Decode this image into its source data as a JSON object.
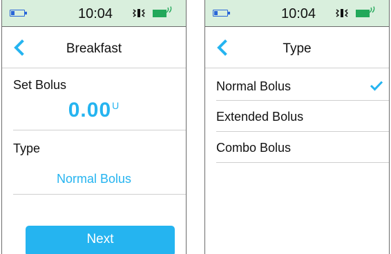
{
  "status": {
    "time": "10:04"
  },
  "left_screen": {
    "title": "Breakfast",
    "set_bolus_label": "Set Bolus",
    "bolus_amount": "0.00",
    "bolus_unit": "U",
    "type_label": "Type",
    "type_value": "Normal Bolus",
    "next_label": "Next"
  },
  "right_screen": {
    "title": "Type",
    "options": [
      {
        "label": "Normal Bolus",
        "selected": true
      },
      {
        "label": "Extended Bolus",
        "selected": false
      },
      {
        "label": "Combo Bolus",
        "selected": false
      }
    ]
  },
  "colors": {
    "accent": "#25b4f0",
    "statusbar": "#d9efdd",
    "battery_full": "#22a85a",
    "battery_low": "#2a66d8"
  },
  "icons": [
    "battery-low-icon",
    "vibrate-icon",
    "battery-charging-icon",
    "back-chevron-icon",
    "checkmark-icon"
  ]
}
